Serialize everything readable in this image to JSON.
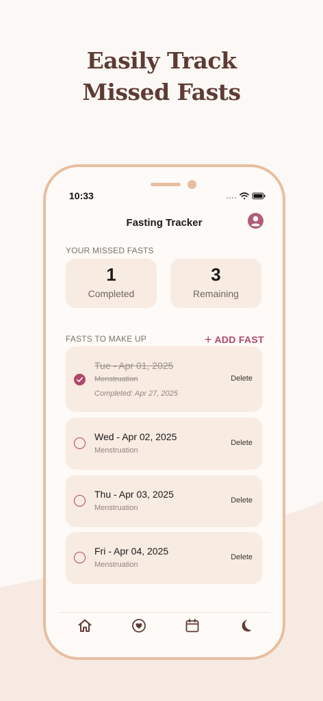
{
  "headline": {
    "line1": "Easily Track",
    "line2": "Missed Fasts"
  },
  "status_bar": {
    "time": "10:33",
    "icons": [
      "signal-icon",
      "wifi-icon",
      "battery-icon"
    ]
  },
  "nav": {
    "title": "Fasting Tracker",
    "profile_icon": "user-circle-icon"
  },
  "missed_section": {
    "label": "YOUR MISSED FASTS",
    "stats": [
      {
        "value": "1",
        "label": "Completed"
      },
      {
        "value": "3",
        "label": "Remaining"
      }
    ]
  },
  "makeup_section": {
    "label": "FASTS TO MAKE UP",
    "add_button": "ADD FAST",
    "add_icon": "+",
    "fasts": [
      {
        "date": "Tue - Apr 01, 2025",
        "reason": "Menstruation",
        "completed_note": "Completed: Apr 27, 2025",
        "done": true,
        "delete_label": "Delete"
      },
      {
        "date": "Wed - Apr 02, 2025",
        "reason": "Menstruation",
        "done": false,
        "delete_label": "Delete"
      },
      {
        "date": "Thu - Apr 03, 2025",
        "reason": "Menstruation",
        "done": false,
        "delete_label": "Delete"
      },
      {
        "date": "Fri - Apr 04, 2025",
        "reason": "Menstruation",
        "done": false,
        "delete_label": "Delete"
      }
    ]
  },
  "tab_bar": {
    "tabs": [
      "home-icon",
      "heart-icon",
      "calendar-icon",
      "moon-icon"
    ]
  },
  "colors": {
    "accent": "#b0476a",
    "headline": "#5e3b34",
    "card": "#f8ebe2",
    "frame": "#e8bea0",
    "background": "#fcf8f5"
  }
}
